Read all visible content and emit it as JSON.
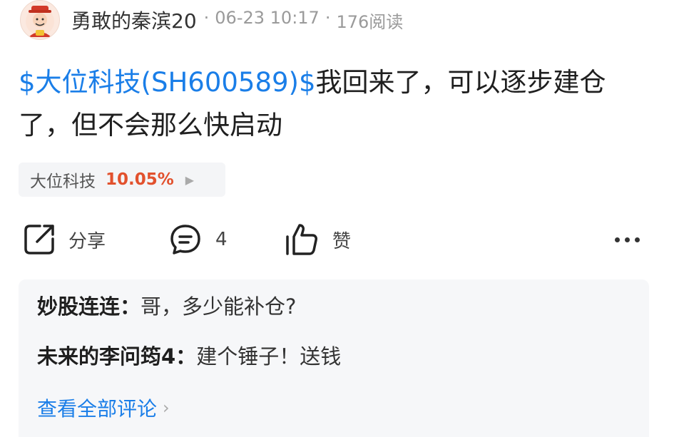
{
  "post": {
    "author": "勇敢的秦滨20",
    "separator": "·",
    "timestamp": "06-23 10:17",
    "reads": "176阅读",
    "stock_link": "$大位科技(SH600589)$",
    "body": "我回来了，可以逐步建仓了，但不会那么快启动"
  },
  "stock_chip": {
    "name": "大位科技",
    "change": "10.05%"
  },
  "actions": {
    "share_label": "分享",
    "comment_count": "4",
    "like_label": "赞"
  },
  "comments": [
    {
      "user": "妙股连连：",
      "text": "哥，多少能补仓?"
    },
    {
      "user": "未来的李问筠4：",
      "text": "建个锤子！送钱"
    }
  ],
  "view_all": "查看全部评论",
  "colors": {
    "link": "#1a7ee8",
    "rise": "#e2512d",
    "panel": "#f6f7f9"
  }
}
